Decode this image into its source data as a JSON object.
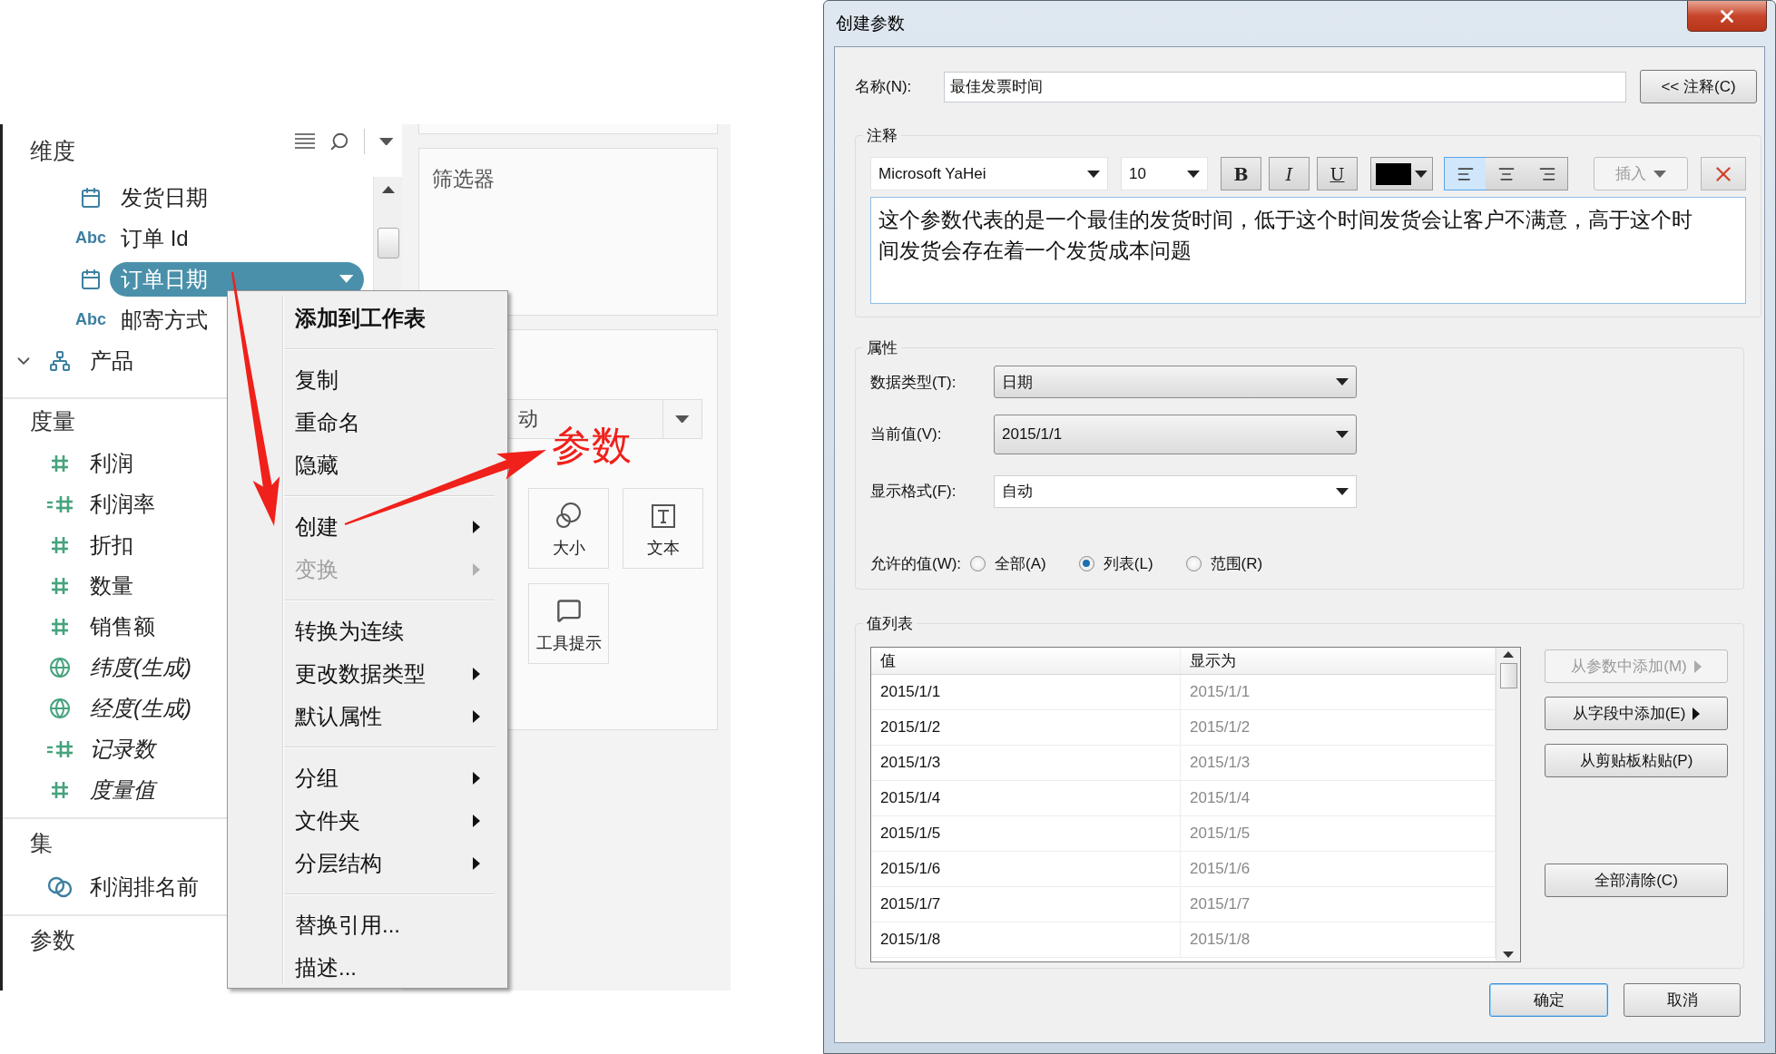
{
  "data_pane": {
    "sections": [
      {
        "title": "维度",
        "items": [
          {
            "kind": "date",
            "label": "发货日期",
            "selected": false
          },
          {
            "kind": "string",
            "type_label": "Abc",
            "label": "订单 Id",
            "selected": false
          },
          {
            "kind": "date",
            "label": "订单日期",
            "selected": true
          },
          {
            "kind": "string",
            "type_label": "Abc",
            "label": "邮寄方式",
            "selected": false
          },
          {
            "kind": "hierarchy",
            "label": "产品",
            "expanded": true,
            "selected": false
          }
        ]
      },
      {
        "title": "度量",
        "items": [
          {
            "kind": "measure",
            "label": "利润",
            "generated": false,
            "selected": false
          },
          {
            "kind": "calc",
            "label": "利润率",
            "generated": false,
            "selected": false
          },
          {
            "kind": "measure",
            "label": "折扣",
            "generated": false,
            "selected": false
          },
          {
            "kind": "measure",
            "label": "数量",
            "generated": false,
            "selected": false
          },
          {
            "kind": "measure",
            "label": "销售额",
            "generated": false,
            "selected": false
          },
          {
            "kind": "geo",
            "label": "纬度(生成)",
            "generated": true,
            "selected": false
          },
          {
            "kind": "geo",
            "label": "经度(生成)",
            "generated": true,
            "selected": false
          },
          {
            "kind": "calc",
            "label": "记录数",
            "generated": true,
            "selected": false
          },
          {
            "kind": "measure",
            "label": "度量值",
            "generated": true,
            "selected": false
          }
        ]
      },
      {
        "title": "集",
        "items": [
          {
            "kind": "set",
            "label": "利润排名前",
            "selected": false
          }
        ]
      },
      {
        "title": "参数"
      }
    ]
  },
  "shelves": {
    "filters_title": "筛选器",
    "marks_type": "动",
    "mark_buttons": [
      {
        "kind": "size",
        "label": "大小"
      },
      {
        "kind": "text",
        "label": "文本"
      },
      {
        "kind": "tooltip",
        "label": "工具提示"
      }
    ]
  },
  "context_menu": [
    {
      "kind": "item",
      "label": "添加到工作表",
      "default": true,
      "disabled": false,
      "submenu": false
    },
    {
      "kind": "separator"
    },
    {
      "kind": "item",
      "label": "复制",
      "default": false,
      "disabled": false,
      "submenu": false
    },
    {
      "kind": "item",
      "label": "重命名",
      "default": false,
      "disabled": false,
      "submenu": false
    },
    {
      "kind": "item",
      "label": "隐藏",
      "default": false,
      "disabled": false,
      "submenu": false
    },
    {
      "kind": "separator"
    },
    {
      "kind": "item",
      "label": "创建",
      "default": false,
      "disabled": false,
      "submenu": true
    },
    {
      "kind": "item",
      "label": "变换",
      "default": false,
      "disabled": true,
      "submenu": true
    },
    {
      "kind": "separator"
    },
    {
      "kind": "item",
      "label": "转换为连续",
      "default": false,
      "disabled": false,
      "submenu": false
    },
    {
      "kind": "item",
      "label": "更改数据类型",
      "default": false,
      "disabled": false,
      "submenu": true
    },
    {
      "kind": "item",
      "label": "默认属性",
      "default": false,
      "disabled": false,
      "submenu": true
    },
    {
      "kind": "separator"
    },
    {
      "kind": "item",
      "label": "分组",
      "default": false,
      "disabled": false,
      "submenu": true
    },
    {
      "kind": "item",
      "label": "文件夹",
      "default": false,
      "disabled": false,
      "submenu": true
    },
    {
      "kind": "item",
      "label": "分层结构",
      "default": false,
      "disabled": false,
      "submenu": true
    },
    {
      "kind": "separator"
    },
    {
      "kind": "item",
      "label": "替换引用...",
      "default": false,
      "disabled": false,
      "submenu": false
    },
    {
      "kind": "item",
      "label": "描述...",
      "default": false,
      "disabled": false,
      "submenu": false
    }
  ],
  "annotation": {
    "label": "参数"
  },
  "dialog": {
    "title": "创建参数",
    "name_label": "名称(N):",
    "name_value": "最佳发票时间",
    "notes_button": "<< 注释(C)",
    "notes_group": "注释",
    "font": "Microsoft YaHei",
    "font_size": "10",
    "format_buttons": [
      {
        "kind": "bold",
        "label": "B"
      },
      {
        "kind": "italic",
        "label": "I"
      },
      {
        "kind": "underline",
        "label": "U"
      }
    ],
    "align_buttons": [
      {
        "kind": "left",
        "selected": true
      },
      {
        "kind": "center",
        "selected": false
      },
      {
        "kind": "right",
        "selected": false
      }
    ],
    "insert_button": {
      "label": "插入",
      "disabled": true
    },
    "notes_text": "这个参数代表的是一个最佳的发货时间，低于这个时间发货会让客户不满意，高于这个时间发货会存在着一个发货成本问题",
    "properties_group": "属性",
    "fields": [
      {
        "kind": "select",
        "label": "数据类型(T):",
        "value": "日期"
      },
      {
        "kind": "select",
        "label": "当前值(V):",
        "value": "2015/1/1"
      },
      {
        "kind": "combo",
        "label": "显示格式(F):",
        "value": "自动"
      }
    ],
    "allowed_label": "允许的值(W):",
    "allowed_options": [
      {
        "label": "全部(A)",
        "selected": false
      },
      {
        "label": "列表(L)",
        "selected": true
      },
      {
        "label": "范围(R)",
        "selected": false
      }
    ],
    "values_group": "值列表",
    "table": {
      "columns": [
        "值",
        "显示为"
      ],
      "rows": [
        [
          "2015/1/1",
          "2015/1/1"
        ],
        [
          "2015/1/2",
          "2015/1/2"
        ],
        [
          "2015/1/3",
          "2015/1/3"
        ],
        [
          "2015/1/4",
          "2015/1/4"
        ],
        [
          "2015/1/5",
          "2015/1/5"
        ],
        [
          "2015/1/6",
          "2015/1/6"
        ],
        [
          "2015/1/7",
          "2015/1/7"
        ],
        [
          "2015/1/8",
          "2015/1/8"
        ]
      ]
    },
    "side_buttons": [
      {
        "label": "从参数中添加(M)",
        "disabled": true,
        "submenu": true
      },
      {
        "label": "从字段中添加(E)",
        "disabled": false,
        "submenu": true
      },
      {
        "label": "从剪贴板粘贴(P)",
        "disabled": false,
        "submenu": false
      },
      {
        "label": "全部清除(C)",
        "disabled": false,
        "submenu": false
      }
    ],
    "ok_button": "确定",
    "cancel_button": "取消"
  }
}
